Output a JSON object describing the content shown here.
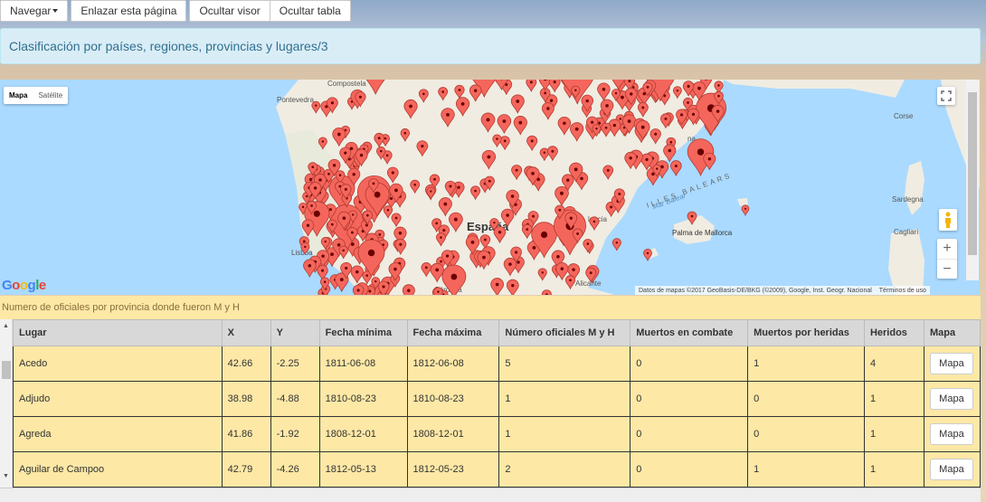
{
  "toolbar": {
    "navegar_label": "Navegar",
    "enlazar_label": "Enlazar esta página",
    "ocultar_visor_label": "Ocultar visor",
    "ocultar_tabla_label": "Ocultar tabla"
  },
  "title": "Clasificación por países, regiones, provincias y lugares/3",
  "map": {
    "type_mapa": "Mapa",
    "type_satelite": "Satélite",
    "labels": {
      "pontevedra": "Pontevedra",
      "compostela": "Compostela",
      "corse": "Corse",
      "sardegna": "Sardegna",
      "cagliari": "Cagliari",
      "portugal": "ugal",
      "espana": "España",
      "valencia": "lencia",
      "nacional": "na",
      "mar_balear": "Mar Balear",
      "illes_balears": "ILLES BALEARS",
      "palma": "Palma de Mallorca",
      "lisboa": "Lisboa",
      "alicante": "Alicante",
      "cordoba": "Córdoba"
    },
    "google": "Google",
    "attribution": "Datos de mapas ©2017 GeoBasis-DE/BKG (©2009), Google, Inst. Geogr. Nacional",
    "terms": "Términos de uso",
    "zoom_in": "+",
    "zoom_out": "−",
    "pegman_icon": "person-icon",
    "fullscreen_icon": "fullscreen-icon",
    "marker_color": "#f4665c"
  },
  "caption": "Numero de oficiales por provincia donde fueron M y H",
  "table": {
    "headers": [
      "Lugar",
      "X",
      "Y",
      "Fecha mínima",
      "Fecha máxima",
      "Número oficiales M y H",
      "Muertos en combate",
      "Muertos por heridas",
      "Heridos",
      "Mapa"
    ],
    "rows": [
      [
        "Acedo",
        "42.66",
        "-2.25",
        "1811-06-08",
        "1812-06-08",
        "5",
        "0",
        "1",
        "4",
        "Mapa"
      ],
      [
        "Adjudo",
        "38.98",
        "-4.88",
        "1810-08-23",
        "1810-08-23",
        "1",
        "0",
        "0",
        "1",
        "Mapa"
      ],
      [
        "Agreda",
        "41.86",
        "-1.92",
        "1808-12-01",
        "1808-12-01",
        "1",
        "0",
        "0",
        "1",
        "Mapa"
      ],
      [
        "Aguilar de Campoo",
        "42.79",
        "-4.26",
        "1812-05-13",
        "1812-05-23",
        "2",
        "0",
        "1",
        "1",
        "Mapa"
      ]
    ]
  }
}
